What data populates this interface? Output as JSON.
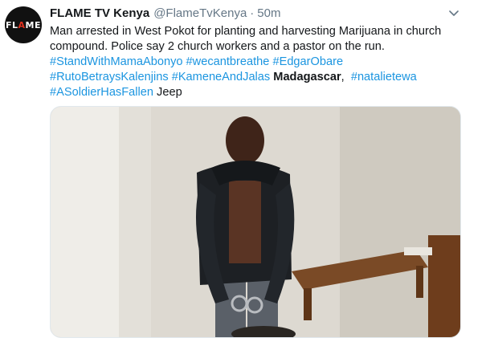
{
  "account": {
    "avatar_text_main": "FL",
    "avatar_text_accent": "A",
    "avatar_text_end": "ME",
    "display_name": "FLAME TV Kenya",
    "handle": "@FlameTvKenya",
    "separator": "·",
    "time": "50m"
  },
  "tweet": {
    "line1": "Man arrested in West Pokot for planting and harvesting Marijuana in church",
    "line2": "compound. Police say 2 church workers and a pastor on the run.",
    "hashtags": {
      "h1": "#StandWithMamaAbonyo",
      "h2": "#wecantbreathe",
      "h3": "#EdgarObare",
      "h4": "#RutoBetraysKalenjins",
      "h5": "#KameneAndJalas",
      "h6": "#natalietewa",
      "h7": "#ASoldierHasFallen"
    },
    "bold_word": "Madagascar",
    "comma": ",",
    "trailing_word": "Jeep"
  },
  "colors": {
    "link": "#1b95e0",
    "text": "#14171a",
    "muted": "#657786",
    "brand_red": "#e0301e"
  },
  "icons": {
    "caret": "chevron-down-icon"
  }
}
